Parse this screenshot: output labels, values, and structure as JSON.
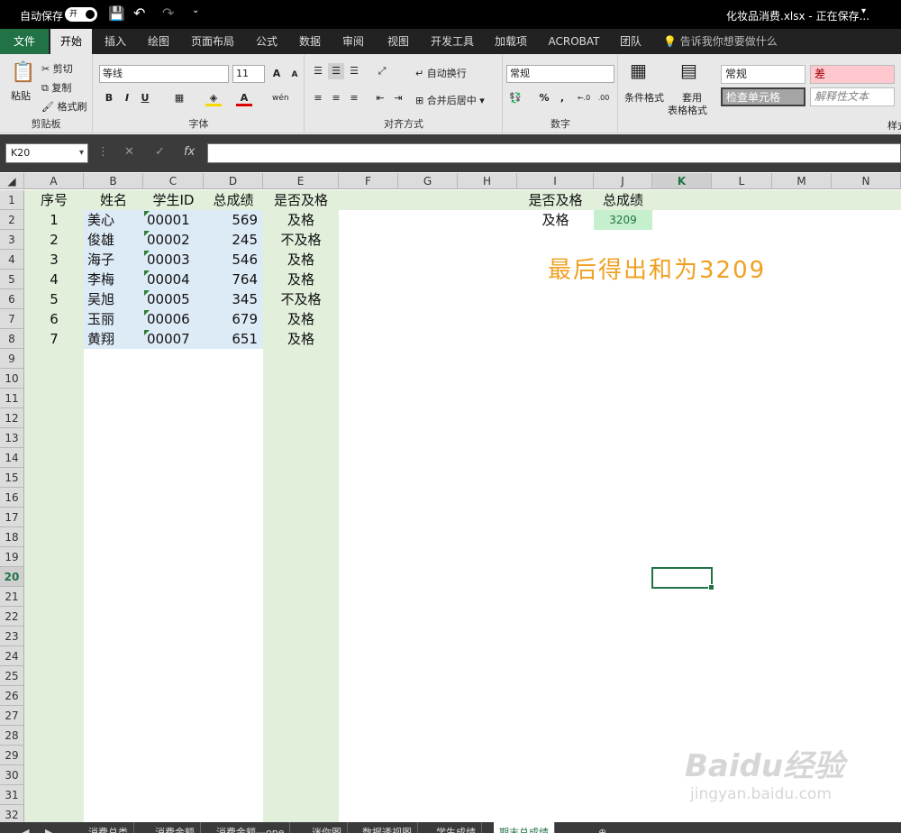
{
  "titlebar": {
    "autosave_label": "自动保存",
    "autosave_state": "开",
    "filename": "化妆品消费.xlsx - 正在保存..."
  },
  "tabs": [
    "文件",
    "开始",
    "插入",
    "绘图",
    "页面布局",
    "公式",
    "数据",
    "审阅",
    "视图",
    "开发工具",
    "加载项",
    "ACROBAT",
    "团队"
  ],
  "tell_me": "告诉我你想要做什么",
  "ribbon": {
    "clipboard": {
      "paste": "粘贴",
      "cut": "剪切",
      "copy": "复制",
      "format_painter": "格式刷",
      "label": "剪贴板"
    },
    "font": {
      "name": "等线",
      "size": "11",
      "bold": "B",
      "italic": "I",
      "underline": "U",
      "phonetic": "wén",
      "label": "字体"
    },
    "alignment": {
      "wrap": "自动换行",
      "merge": "合并后居中",
      "label": "对齐方式"
    },
    "number": {
      "format": "常规",
      "percent": "%",
      "comma": ",",
      "label": "数字"
    },
    "styles": {
      "conditional": "条件格式",
      "table_format_1": "套用",
      "table_format_2": "表格格式",
      "style_normal": "常规",
      "style_bad": "差",
      "style_check": "检查单元格",
      "style_explain": "解释性文本",
      "label": "样式"
    }
  },
  "formula_bar": {
    "namebox": "K20",
    "value": ""
  },
  "columns": [
    "A",
    "B",
    "C",
    "D",
    "E",
    "F",
    "G",
    "H",
    "I",
    "J",
    "K",
    "L",
    "M",
    "N"
  ],
  "selected_column": "K",
  "selected_row": "20",
  "rows": [
    "1",
    "2",
    "3",
    "4",
    "5",
    "6",
    "7",
    "8",
    "9",
    "10",
    "11",
    "12",
    "13",
    "14",
    "15",
    "16",
    "17",
    "18",
    "19",
    "20",
    "21",
    "22",
    "23",
    "24",
    "25",
    "26",
    "27",
    "28",
    "29",
    "30",
    "31",
    "32"
  ],
  "table": {
    "headers": [
      "序号",
      "姓名",
      "学生ID",
      "总成绩",
      "是否及格"
    ],
    "rows": [
      [
        "1",
        "美心",
        "00001",
        "569",
        "及格"
      ],
      [
        "2",
        "俊雄",
        "00002",
        "245",
        "不及格"
      ],
      [
        "3",
        "海子",
        "00003",
        "546",
        "及格"
      ],
      [
        "4",
        "李梅",
        "00004",
        "764",
        "及格"
      ],
      [
        "5",
        "吴旭",
        "00005",
        "345",
        "不及格"
      ],
      [
        "6",
        "玉丽",
        "00006",
        "679",
        "及格"
      ],
      [
        "7",
        "黄翔",
        "00007",
        "651",
        "及格"
      ]
    ]
  },
  "summary": {
    "header_i": "是否及格",
    "header_j": "总成绩",
    "value_i": "及格",
    "value_j": "3209"
  },
  "annotation": "最后得出和为3209",
  "sheet_tabs": [
    "消费总类",
    "消费金额",
    "消费金额—one",
    "迷你图",
    "数据透视图",
    "学生成绩",
    "期末总成绩"
  ],
  "active_sheet": "期末总成绩",
  "watermark": {
    "brand": "Baidu经验",
    "url": "jingyan.baidu.com"
  },
  "colors": {
    "accent": "#217346",
    "tab_fill": "#e2efda",
    "sheet_fill": "#ddebf7",
    "annotation": "#f0a020",
    "sum_fill": "#c6efce"
  }
}
